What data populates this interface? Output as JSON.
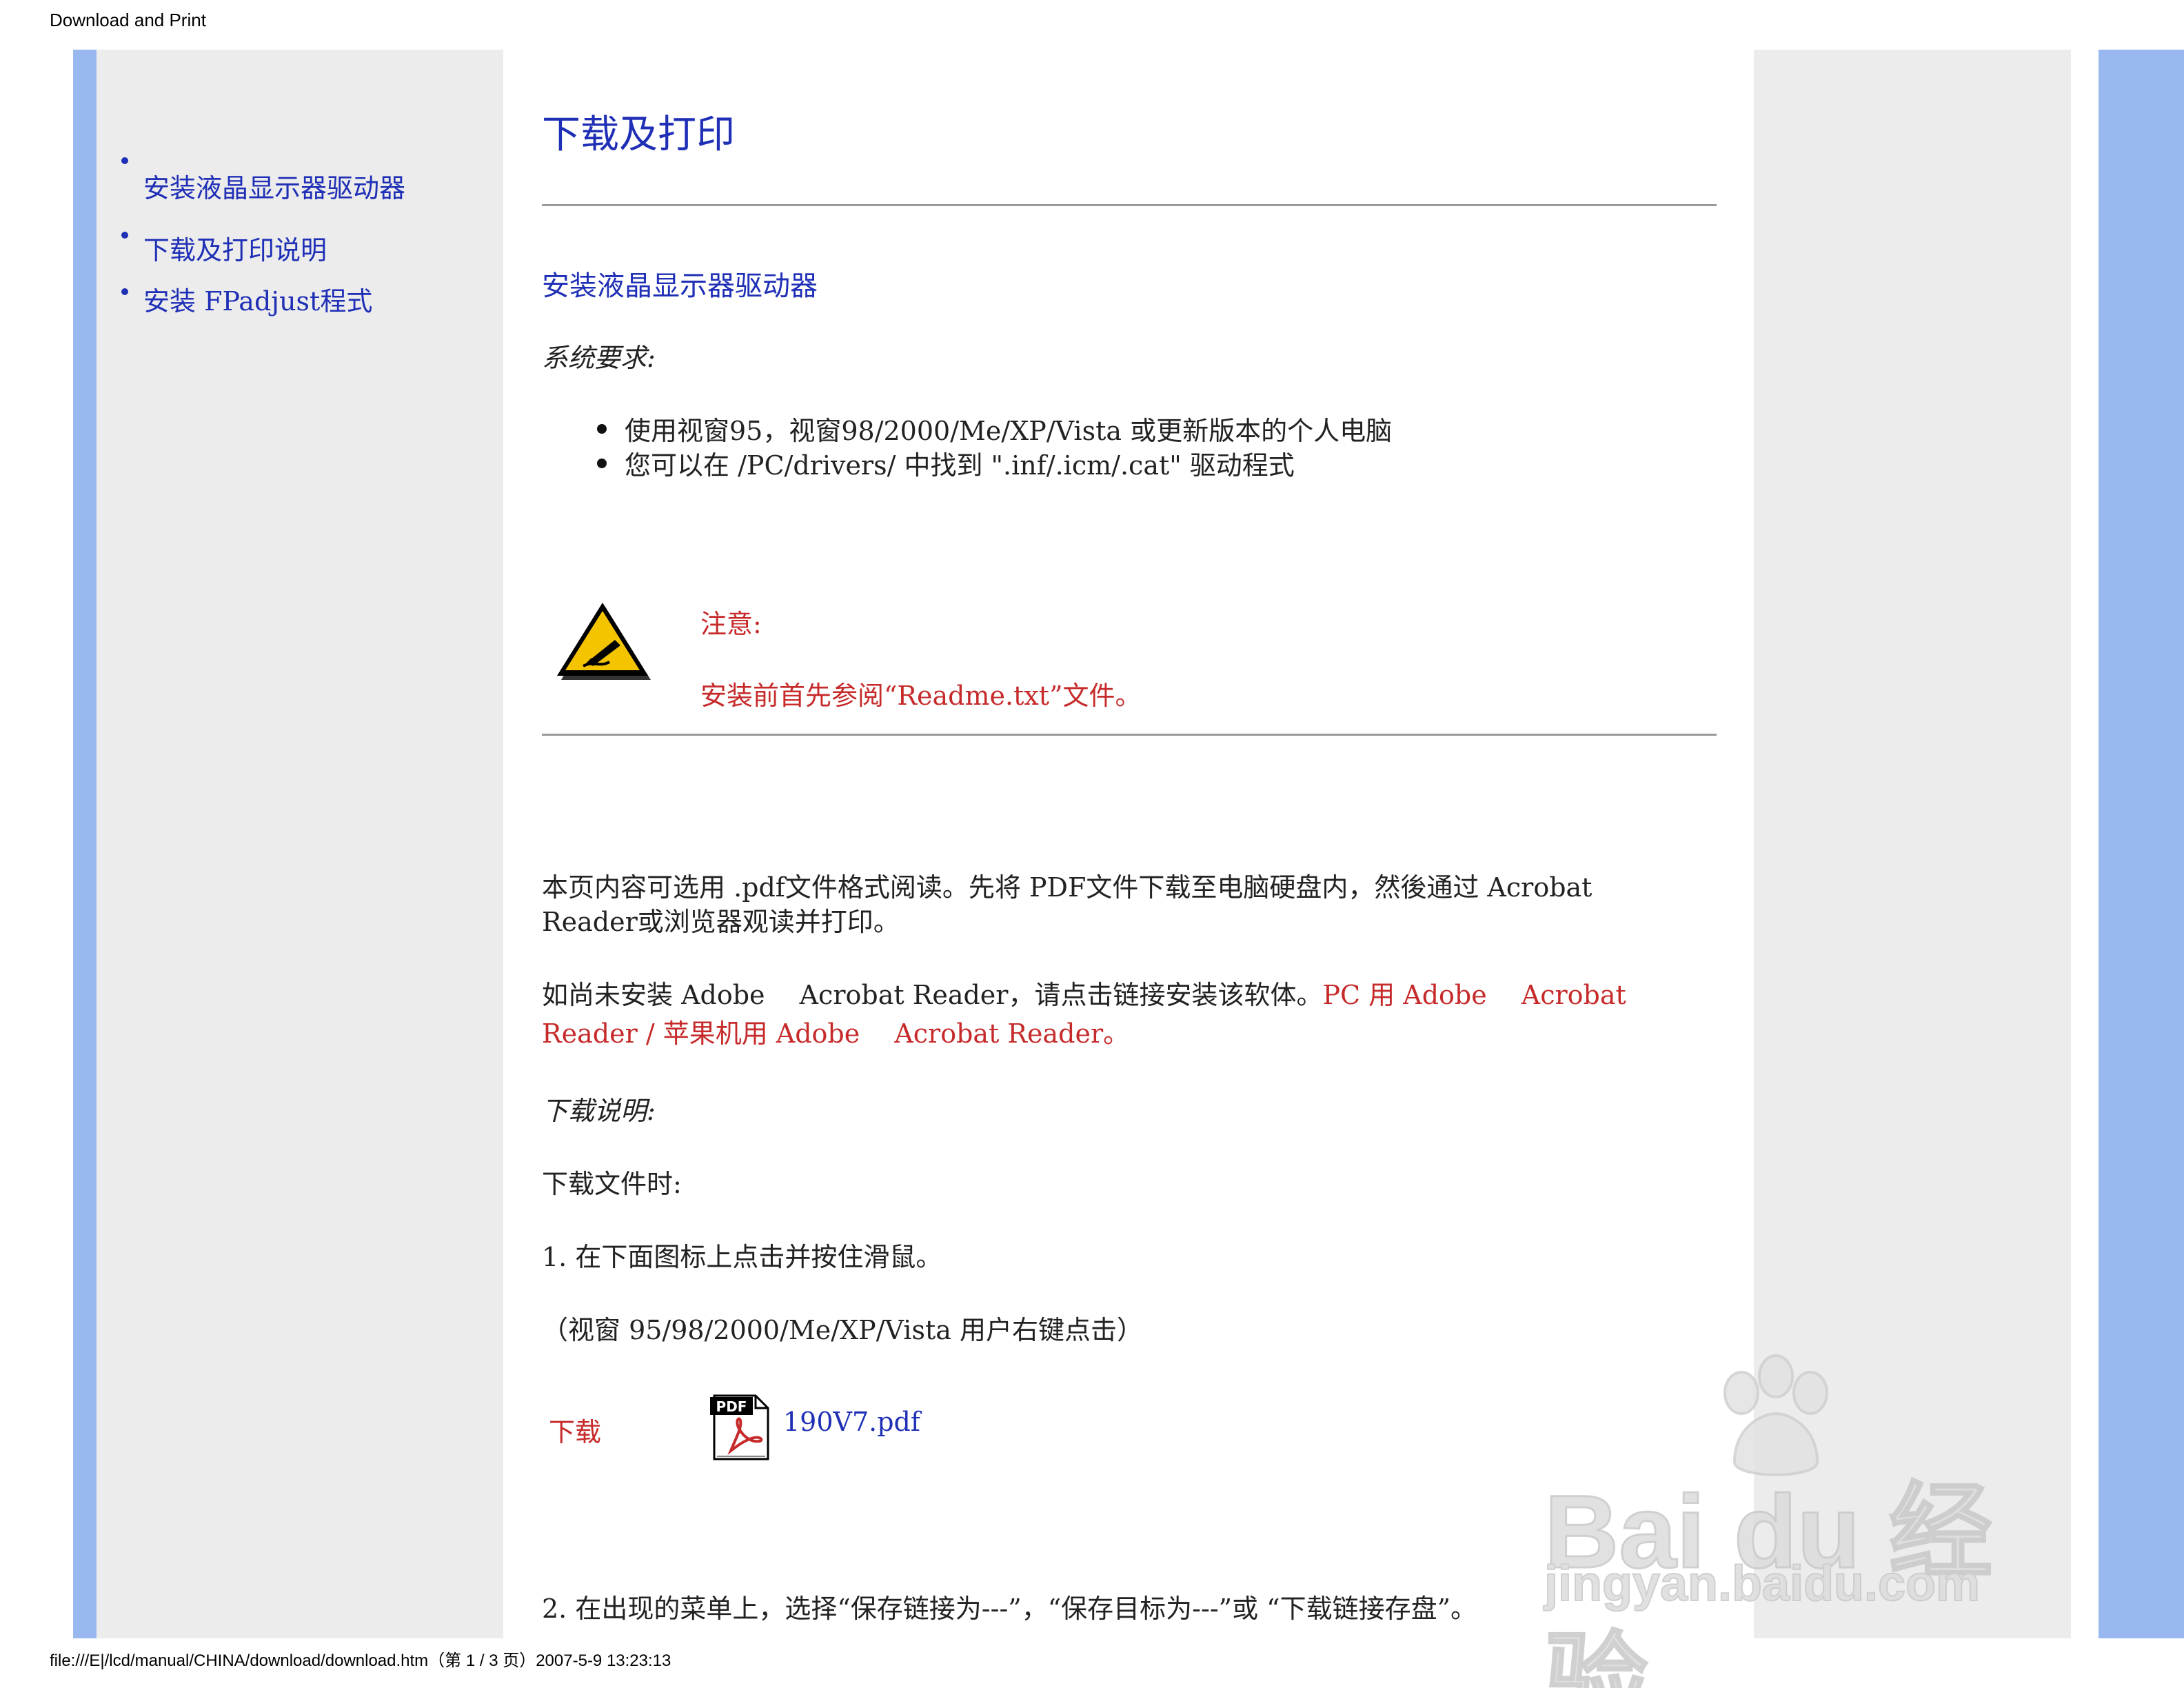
{
  "print_header": "Download and Print",
  "print_footer": "file:///E|/lcd/manual/CHINA/download/download.htm（第 1 / 3 页）2007-5-9 13:23:13",
  "sidebar": {
    "items": [
      {
        "label": "安装液晶显示器驱动器"
      },
      {
        "label": "下载及打印说明"
      },
      {
        "label": "安装 FPadjust程式"
      }
    ]
  },
  "main": {
    "page_title": "下载及打印",
    "section_title": "安装液晶显示器驱动器",
    "requirements_label": "系统要求:",
    "requirements": [
      "使用视窗95，视窗98/2000/Me/XP/Vista 或更新版本的个人电脑",
      "您可以在 /PC/drivers/ 中找到 \".inf/.icm/.cat\" 驱动程式"
    ],
    "note_label": "注意:",
    "note_text": "安装前首先参阅“Readme.txt”文件。",
    "pdf_intro_line1": "本页内容可选用 .pdf文件格式阅读。先将 PDF文件下载至电脑硬盘内，然後通过 Acrobat",
    "pdf_intro_line2": "Reader或浏览器观读并打印。",
    "adobe_line1_text": "如尚未安装 Adobe　 Acrobat Reader，请点击链接安装该软体。",
    "adobe_link_pc": "PC 用 Adobe　 Acrobat",
    "adobe_link_pc2": "Reader",
    "adobe_sep": " / ",
    "adobe_link_mac": "苹果机用 Adobe　 Acrobat Reader。",
    "download_instructions_label": "下载说明:",
    "download_when": "下载文件时:",
    "step1": "1. 在下面图标上点击并按住滑鼠。",
    "step1_note": "（视窗 95/98/2000/Me/XP/Vista 用户右键点击）",
    "download_label": "下载",
    "pdf_file": "190V7.pdf",
    "step2": "2. 在出现的菜单上，选择“保存链接为---”，“保存目标为---”或 “下载链接存盘”。"
  },
  "watermark": {
    "brand": "Bai du 经验",
    "domain": "jingyan.baidu.com"
  }
}
